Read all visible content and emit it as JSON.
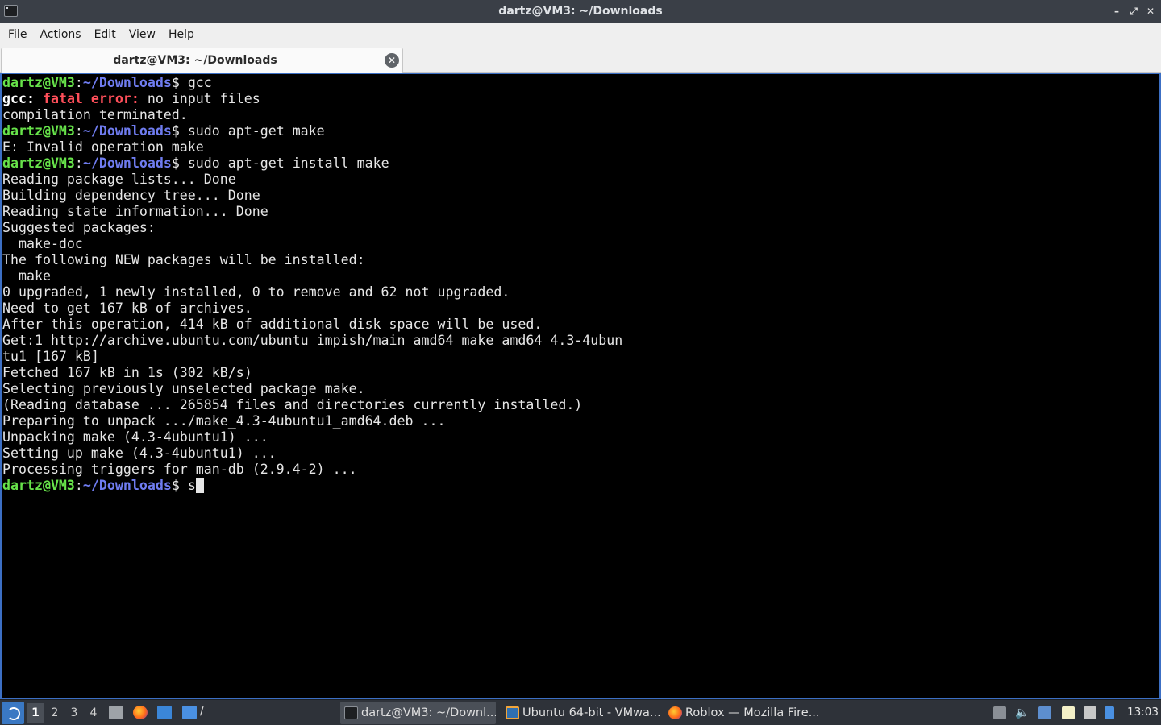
{
  "window": {
    "title": "dartz@VM3: ~/Downloads",
    "controls": {
      "minimize": "–",
      "maximize": "⤢",
      "close": "✕"
    }
  },
  "menubar": {
    "items": [
      "File",
      "Actions",
      "Edit",
      "View",
      "Help"
    ]
  },
  "tabs": [
    {
      "label": "dartz@VM3: ~/Downloads",
      "close": "✕"
    }
  ],
  "terminal": {
    "prompt": {
      "user_host": "dartz@VM3",
      "sep": ":",
      "path": "~/Downloads",
      "symbol": "$"
    },
    "lines": [
      {
        "kind": "cmd",
        "text": " gcc"
      },
      {
        "kind": "gccerr",
        "name": "gcc:",
        "err": "fatal error:",
        "rest": " no input files"
      },
      {
        "kind": "out",
        "text": "compilation terminated."
      },
      {
        "kind": "cmd",
        "text": " sudo apt-get make"
      },
      {
        "kind": "out",
        "text": "E: Invalid operation make"
      },
      {
        "kind": "cmd",
        "text": " sudo apt-get install make"
      },
      {
        "kind": "out",
        "text": "Reading package lists... Done"
      },
      {
        "kind": "out",
        "text": "Building dependency tree... Done"
      },
      {
        "kind": "out",
        "text": "Reading state information... Done"
      },
      {
        "kind": "out",
        "text": "Suggested packages:"
      },
      {
        "kind": "out",
        "text": "  make-doc"
      },
      {
        "kind": "out",
        "text": "The following NEW packages will be installed:"
      },
      {
        "kind": "out",
        "text": "  make"
      },
      {
        "kind": "out",
        "text": "0 upgraded, 1 newly installed, 0 to remove and 62 not upgraded."
      },
      {
        "kind": "out",
        "text": "Need to get 167 kB of archives."
      },
      {
        "kind": "out",
        "text": "After this operation, 414 kB of additional disk space will be used."
      },
      {
        "kind": "out",
        "text": "Get:1 http://archive.ubuntu.com/ubuntu impish/main amd64 make amd64 4.3-4ubun"
      },
      {
        "kind": "out",
        "text": "tu1 [167 kB]"
      },
      {
        "kind": "out",
        "text": "Fetched 167 kB in 1s (302 kB/s)"
      },
      {
        "kind": "out",
        "text": "Selecting previously unselected package make."
      },
      {
        "kind": "out",
        "text": "(Reading database ... 265854 files and directories currently installed.)"
      },
      {
        "kind": "out",
        "text": "Preparing to unpack .../make_4.3-4ubuntu1_amd64.deb ..."
      },
      {
        "kind": "out",
        "text": "Unpacking make (4.3-4ubuntu1) ..."
      },
      {
        "kind": "out",
        "text": "Setting up make (4.3-4ubuntu1) ..."
      },
      {
        "kind": "out",
        "text": "Processing triggers for man-db (2.9.4-2) ..."
      },
      {
        "kind": "cmd",
        "text": " s",
        "cursor": true
      }
    ]
  },
  "taskbar": {
    "workspaces": [
      "1",
      "2",
      "3",
      "4"
    ],
    "active_workspace": "1",
    "folder_label": "/",
    "tasks": [
      {
        "label": "dartz@VM3: ~/Downl...",
        "icon": "terminal-icon",
        "active": true
      },
      {
        "label": "Ubuntu 64-bit - VMwa...",
        "icon": "vmware-icon",
        "active": false
      },
      {
        "label": "Roblox — Mozilla Fire...",
        "icon": "firefox-icon",
        "active": false
      }
    ],
    "clock": "13:03"
  },
  "colors": {
    "prompt_user": "#67e34a",
    "prompt_path": "#6f7cf0",
    "error": "#ff4f5a",
    "focus_border": "#3c6fc4"
  }
}
